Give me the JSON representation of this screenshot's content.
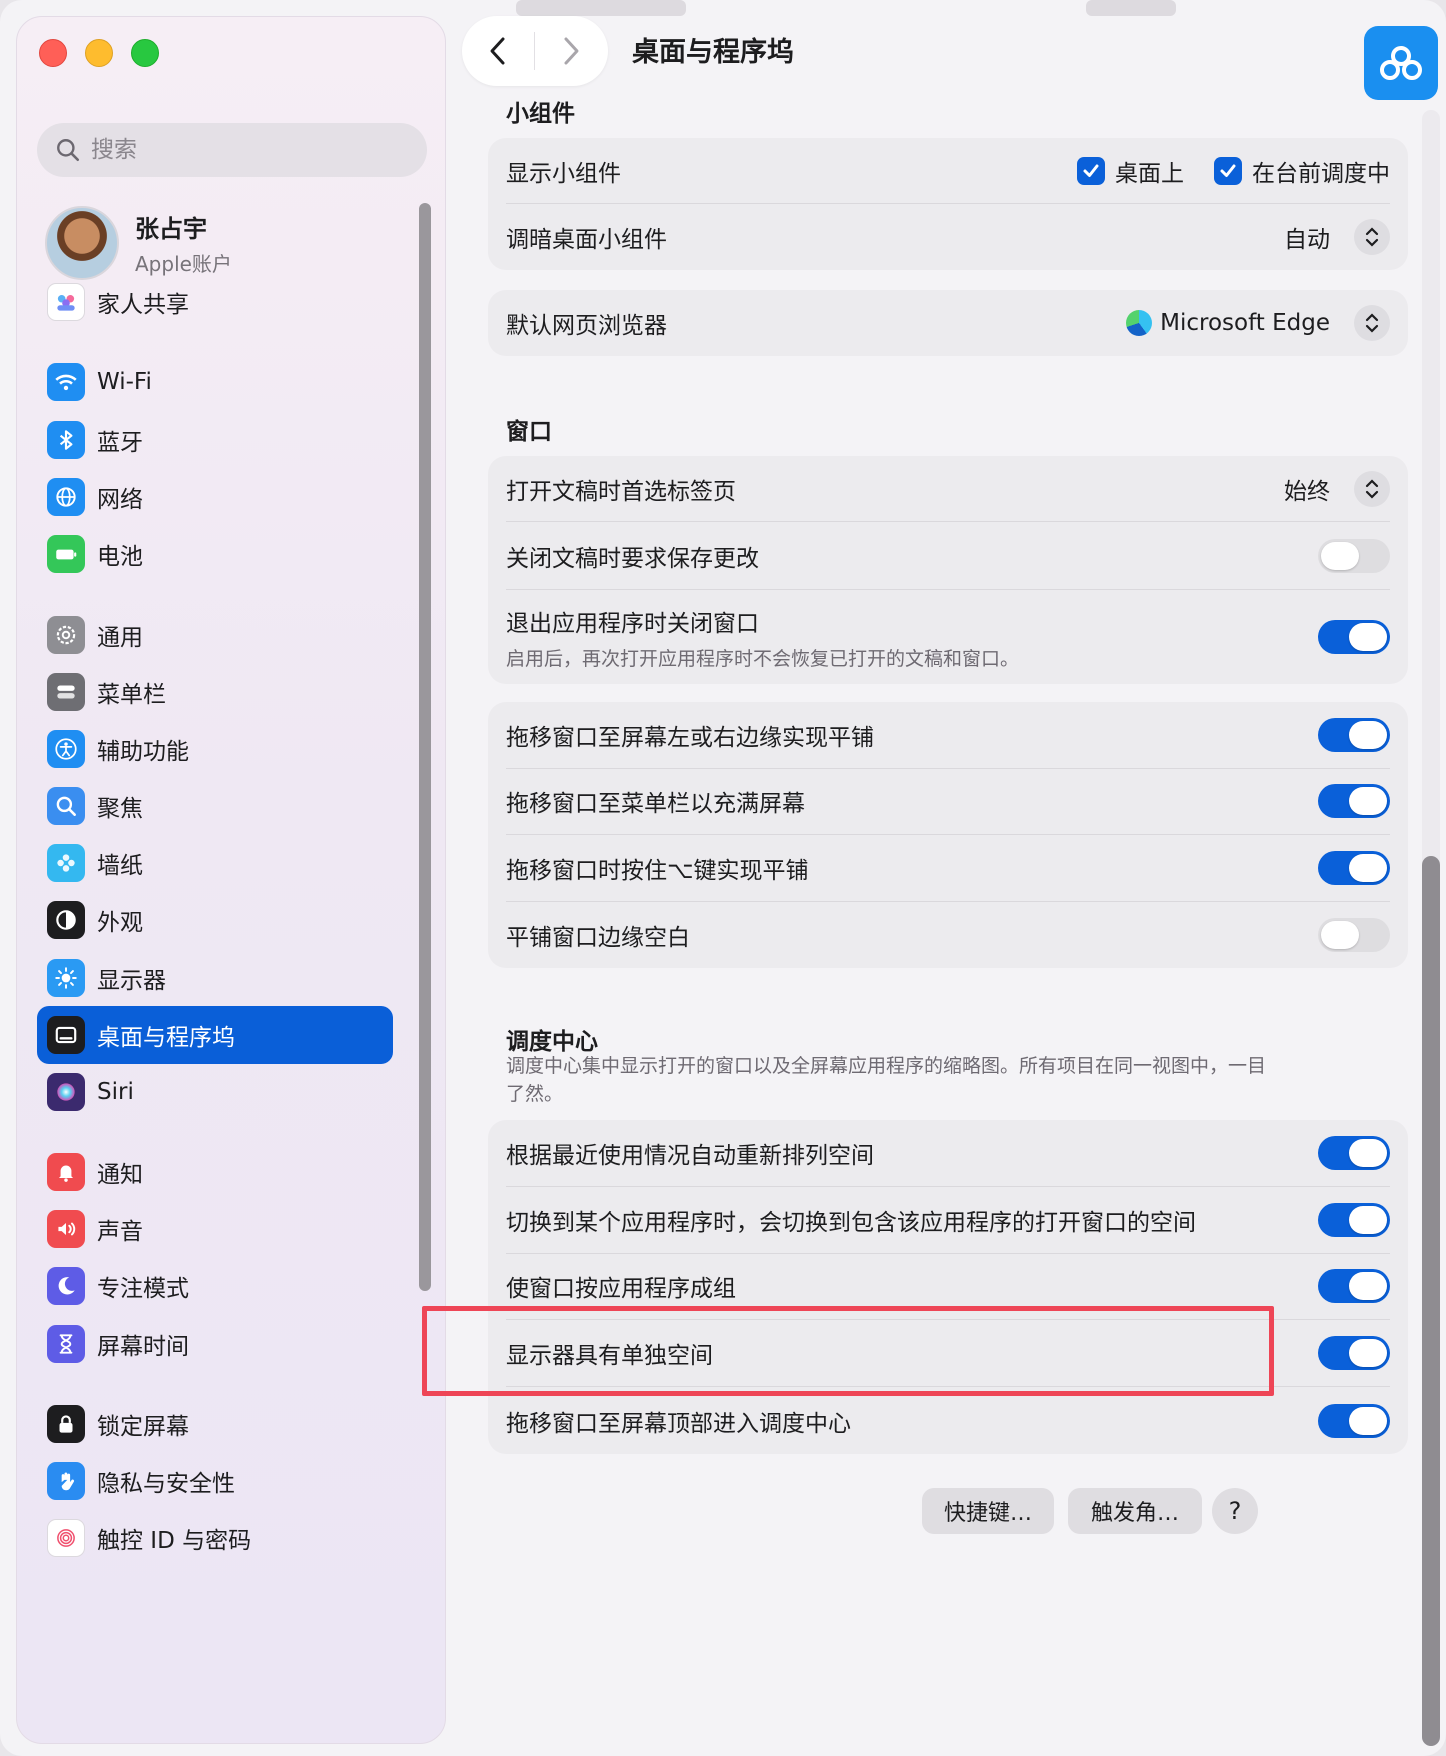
{
  "sidebar": {
    "search_placeholder": "搜索",
    "profile": {
      "name": "张占宇",
      "subtitle": "Apple账户"
    },
    "items": [
      {
        "label": "家人共享",
        "icon": "family-icon",
        "color": "#ffffff"
      },
      {
        "label": "Wi-Fi",
        "icon": "wifi-icon",
        "color": "#1f8ef2"
      },
      {
        "label": "蓝牙",
        "icon": "bluetooth-icon",
        "color": "#1f8ef2"
      },
      {
        "label": "网络",
        "icon": "globe-icon",
        "color": "#1f8ef2"
      },
      {
        "label": "电池",
        "icon": "battery-icon",
        "color": "#34c759"
      },
      {
        "label": "通用",
        "icon": "gear-icon",
        "color": "#8e8e93"
      },
      {
        "label": "菜单栏",
        "icon": "menubar-icon",
        "color": "#6e6e73"
      },
      {
        "label": "辅助功能",
        "icon": "accessibility-icon",
        "color": "#1f8ef2"
      },
      {
        "label": "聚焦",
        "icon": "spotlight-icon",
        "color": "#3a8ef0"
      },
      {
        "label": "墙纸",
        "icon": "wallpaper-icon",
        "color": "#34b8f0"
      },
      {
        "label": "外观",
        "icon": "appearance-icon",
        "color": "#1d1d1f"
      },
      {
        "label": "显示器",
        "icon": "display-icon",
        "color": "#2a9af3"
      },
      {
        "label": "桌面与程序坞",
        "icon": "dock-icon",
        "color": "#1d1d1f"
      },
      {
        "label": "Siri",
        "icon": "siri-icon",
        "color": "#3b2a6e"
      },
      {
        "label": "通知",
        "icon": "bell-icon",
        "color": "#f04b4f"
      },
      {
        "label": "声音",
        "icon": "speaker-icon",
        "color": "#f04b4f"
      },
      {
        "label": "专注模式",
        "icon": "moon-icon",
        "color": "#5e5ce6"
      },
      {
        "label": "屏幕时间",
        "icon": "hourglass-icon",
        "color": "#5e5ce6"
      },
      {
        "label": "锁定屏幕",
        "icon": "lock-icon",
        "color": "#1d1d1f"
      },
      {
        "label": "隐私与安全性",
        "icon": "hand-icon",
        "color": "#2a8cf1"
      },
      {
        "label": "触控 ID 与密码",
        "icon": "fingerprint-icon",
        "color": "#ffffff"
      }
    ],
    "active_index": 12
  },
  "header": {
    "title": "桌面与程序坞",
    "back_icon": "chevron-left-icon",
    "forward_icon": "chevron-right-icon"
  },
  "sections": {
    "widgets": {
      "title": "小组件",
      "show_widgets": {
        "label": "显示小组件",
        "opt1": "桌面上",
        "opt2": "在台前调度中"
      },
      "dim_widgets": {
        "label": "调暗桌面小组件",
        "value": "自动"
      }
    },
    "browser": {
      "label": "默认网页浏览器",
      "value": "Microsoft Edge"
    },
    "windows": {
      "title": "窗口",
      "prefer_tabs": {
        "label": "打开文稿时首选标签页",
        "value": "始终"
      },
      "ask_keep": {
        "label": "关闭文稿时要求保存更改",
        "on": false
      },
      "close_windows": {
        "label": "退出应用程序时关闭窗口",
        "desc": "启用后，再次打开应用程序时不会恢复已打开的文稿和窗口。",
        "on": true
      }
    },
    "tiling": [
      {
        "label": "拖移窗口至屏幕左或右边缘实现平铺",
        "on": true
      },
      {
        "label": "拖移窗口至菜单栏以充满屏幕",
        "on": true
      },
      {
        "label": "拖移窗口时按住⌥键实现平铺",
        "on": true
      },
      {
        "label": "平铺窗口边缘空白",
        "on": false
      }
    ],
    "mission_control": {
      "title": "调度中心",
      "desc": "调度中心集中显示打开的窗口以及全屏幕应用程序的缩略图。所有项目在同一视图中，一目了然。",
      "rows": [
        {
          "label": "根据最近使用情况自动重新排列空间",
          "on": true
        },
        {
          "label": "切换到某个应用程序时，会切换到包含该应用程序的打开窗口的空间",
          "on": true
        },
        {
          "label": "使窗口按应用程序成组",
          "on": true
        },
        {
          "label": "显示器具有单独空间",
          "on": true
        },
        {
          "label": "拖移窗口至屏幕顶部进入调度中心",
          "on": true
        }
      ]
    }
  },
  "footer": {
    "shortcuts": "快捷键…",
    "hot_corners": "触发角…",
    "help": "?"
  },
  "colors": {
    "accent": "#0a60d9",
    "highlight": "#ee4556"
  }
}
